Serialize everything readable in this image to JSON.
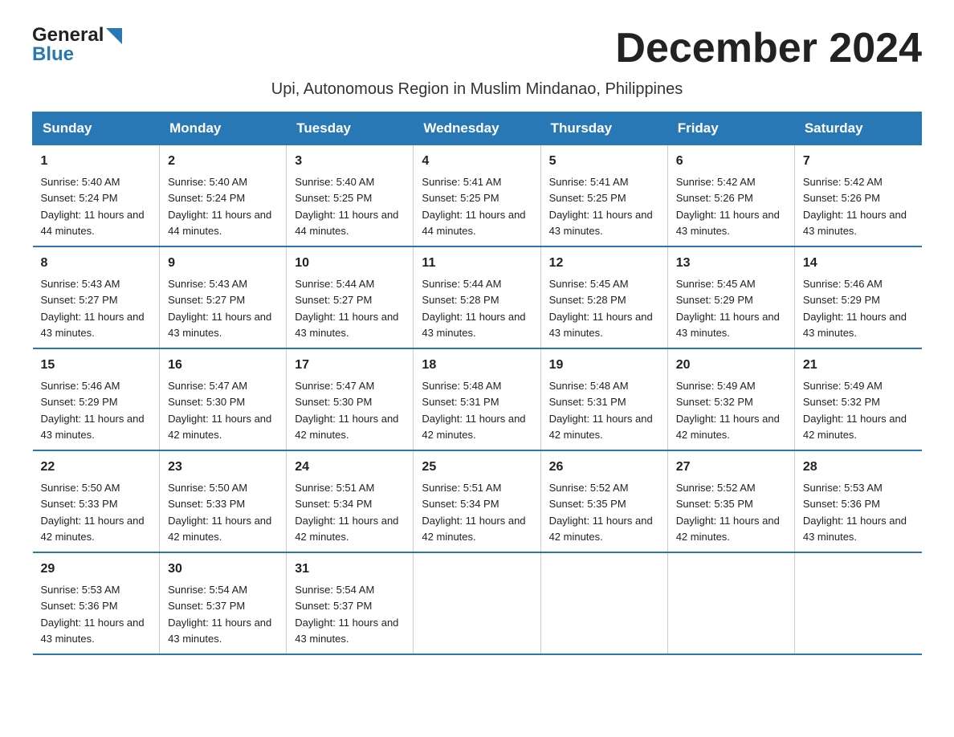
{
  "header": {
    "logo_general": "General",
    "logo_blue": "Blue",
    "month_title": "December 2024",
    "subtitle": "Upi, Autonomous Region in Muslim Mindanao, Philippines"
  },
  "days_of_week": [
    "Sunday",
    "Monday",
    "Tuesday",
    "Wednesday",
    "Thursday",
    "Friday",
    "Saturday"
  ],
  "weeks": [
    [
      {
        "day": "1",
        "sunrise": "5:40 AM",
        "sunset": "5:24 PM",
        "daylight": "11 hours and 44 minutes."
      },
      {
        "day": "2",
        "sunrise": "5:40 AM",
        "sunset": "5:24 PM",
        "daylight": "11 hours and 44 minutes."
      },
      {
        "day": "3",
        "sunrise": "5:40 AM",
        "sunset": "5:25 PM",
        "daylight": "11 hours and 44 minutes."
      },
      {
        "day": "4",
        "sunrise": "5:41 AM",
        "sunset": "5:25 PM",
        "daylight": "11 hours and 44 minutes."
      },
      {
        "day": "5",
        "sunrise": "5:41 AM",
        "sunset": "5:25 PM",
        "daylight": "11 hours and 43 minutes."
      },
      {
        "day": "6",
        "sunrise": "5:42 AM",
        "sunset": "5:26 PM",
        "daylight": "11 hours and 43 minutes."
      },
      {
        "day": "7",
        "sunrise": "5:42 AM",
        "sunset": "5:26 PM",
        "daylight": "11 hours and 43 minutes."
      }
    ],
    [
      {
        "day": "8",
        "sunrise": "5:43 AM",
        "sunset": "5:27 PM",
        "daylight": "11 hours and 43 minutes."
      },
      {
        "day": "9",
        "sunrise": "5:43 AM",
        "sunset": "5:27 PM",
        "daylight": "11 hours and 43 minutes."
      },
      {
        "day": "10",
        "sunrise": "5:44 AM",
        "sunset": "5:27 PM",
        "daylight": "11 hours and 43 minutes."
      },
      {
        "day": "11",
        "sunrise": "5:44 AM",
        "sunset": "5:28 PM",
        "daylight": "11 hours and 43 minutes."
      },
      {
        "day": "12",
        "sunrise": "5:45 AM",
        "sunset": "5:28 PM",
        "daylight": "11 hours and 43 minutes."
      },
      {
        "day": "13",
        "sunrise": "5:45 AM",
        "sunset": "5:29 PM",
        "daylight": "11 hours and 43 minutes."
      },
      {
        "day": "14",
        "sunrise": "5:46 AM",
        "sunset": "5:29 PM",
        "daylight": "11 hours and 43 minutes."
      }
    ],
    [
      {
        "day": "15",
        "sunrise": "5:46 AM",
        "sunset": "5:29 PM",
        "daylight": "11 hours and 43 minutes."
      },
      {
        "day": "16",
        "sunrise": "5:47 AM",
        "sunset": "5:30 PM",
        "daylight": "11 hours and 42 minutes."
      },
      {
        "day": "17",
        "sunrise": "5:47 AM",
        "sunset": "5:30 PM",
        "daylight": "11 hours and 42 minutes."
      },
      {
        "day": "18",
        "sunrise": "5:48 AM",
        "sunset": "5:31 PM",
        "daylight": "11 hours and 42 minutes."
      },
      {
        "day": "19",
        "sunrise": "5:48 AM",
        "sunset": "5:31 PM",
        "daylight": "11 hours and 42 minutes."
      },
      {
        "day": "20",
        "sunrise": "5:49 AM",
        "sunset": "5:32 PM",
        "daylight": "11 hours and 42 minutes."
      },
      {
        "day": "21",
        "sunrise": "5:49 AM",
        "sunset": "5:32 PM",
        "daylight": "11 hours and 42 minutes."
      }
    ],
    [
      {
        "day": "22",
        "sunrise": "5:50 AM",
        "sunset": "5:33 PM",
        "daylight": "11 hours and 42 minutes."
      },
      {
        "day": "23",
        "sunrise": "5:50 AM",
        "sunset": "5:33 PM",
        "daylight": "11 hours and 42 minutes."
      },
      {
        "day": "24",
        "sunrise": "5:51 AM",
        "sunset": "5:34 PM",
        "daylight": "11 hours and 42 minutes."
      },
      {
        "day": "25",
        "sunrise": "5:51 AM",
        "sunset": "5:34 PM",
        "daylight": "11 hours and 42 minutes."
      },
      {
        "day": "26",
        "sunrise": "5:52 AM",
        "sunset": "5:35 PM",
        "daylight": "11 hours and 42 minutes."
      },
      {
        "day": "27",
        "sunrise": "5:52 AM",
        "sunset": "5:35 PM",
        "daylight": "11 hours and 42 minutes."
      },
      {
        "day": "28",
        "sunrise": "5:53 AM",
        "sunset": "5:36 PM",
        "daylight": "11 hours and 43 minutes."
      }
    ],
    [
      {
        "day": "29",
        "sunrise": "5:53 AM",
        "sunset": "5:36 PM",
        "daylight": "11 hours and 43 minutes."
      },
      {
        "day": "30",
        "sunrise": "5:54 AM",
        "sunset": "5:37 PM",
        "daylight": "11 hours and 43 minutes."
      },
      {
        "day": "31",
        "sunrise": "5:54 AM",
        "sunset": "5:37 PM",
        "daylight": "11 hours and 43 minutes."
      },
      null,
      null,
      null,
      null
    ]
  ]
}
